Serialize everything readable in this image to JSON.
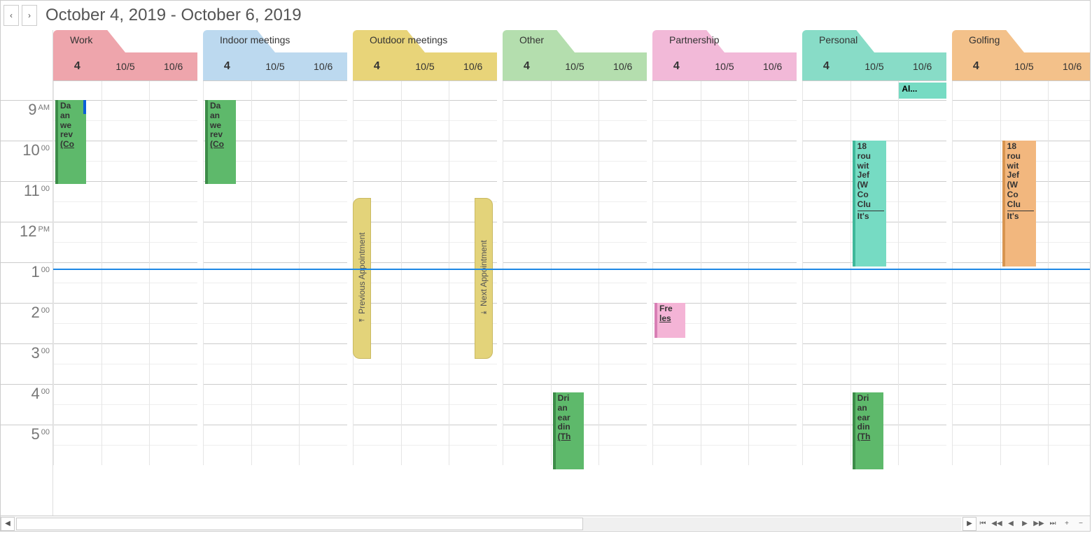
{
  "title": "October 4, 2019 - October 6, 2019",
  "nav": {
    "prev": "‹",
    "next": "›"
  },
  "time_slots": [
    {
      "hour": "9",
      "suffix": "AM"
    },
    {
      "hour": "10",
      "suffix": "00"
    },
    {
      "hour": "11",
      "suffix": "00"
    },
    {
      "hour": "12",
      "suffix": "PM"
    },
    {
      "hour": "1",
      "suffix": "00"
    },
    {
      "hour": "2",
      "suffix": "00"
    },
    {
      "hour": "3",
      "suffix": "00"
    },
    {
      "hour": "4",
      "suffix": "00"
    },
    {
      "hour": "5",
      "suffix": "00"
    }
  ],
  "dates": {
    "d0": "4",
    "d1": "10/5",
    "d2": "10/6"
  },
  "groups": [
    {
      "id": "work",
      "label": "Work",
      "colorClass": "c-work"
    },
    {
      "id": "indoor",
      "label": "Indoor meetings",
      "colorClass": "c-indoor"
    },
    {
      "id": "outdoor",
      "label": "Outdoor meetings",
      "colorClass": "c-outdoor"
    },
    {
      "id": "other",
      "label": "Other",
      "colorClass": "c-other"
    },
    {
      "id": "partnership",
      "label": "Partnership",
      "colorClass": "c-partner"
    },
    {
      "id": "personal",
      "label": "Personal",
      "colorClass": "c-personal"
    },
    {
      "id": "golfing",
      "label": "Golfing",
      "colorClass": "c-golf"
    }
  ],
  "events": {
    "work_dan": {
      "lines": [
        "Da",
        "an",
        "we",
        "rev"
      ],
      "underline": "(Co"
    },
    "indoor_dan": {
      "lines": [
        "Da",
        "an",
        "we",
        "rev"
      ],
      "underline": "(Co"
    },
    "partner_free": {
      "lines": [
        "Fre"
      ],
      "underline": "les"
    },
    "other_dri": {
      "lines": [
        "Dri",
        "an",
        "ear",
        "din"
      ],
      "underline": "(Th"
    },
    "personal_dri": {
      "lines": [
        "Dri",
        "an",
        "ear",
        "din"
      ],
      "underline": "(Th"
    },
    "personal_18": {
      "lines": [
        "18",
        "rou",
        "wit",
        "Jef",
        "(W",
        "Co",
        "Clu"
      ],
      "post": "It's"
    },
    "golf_18": {
      "lines": [
        "18",
        "rou",
        "wit",
        "Jef",
        "(W",
        "Co",
        "Clu"
      ],
      "post": "It's"
    },
    "personal_allday": "Al..."
  },
  "pills": {
    "prev": "Previous Appointment",
    "next": "Next Appointment"
  },
  "mini_nav": {
    "first": "⏮",
    "fastback": "◀◀",
    "back": "◀",
    "play": "▶",
    "fastfwd": "▶▶",
    "last": "⏭",
    "plus": "+",
    "minus": "−"
  }
}
